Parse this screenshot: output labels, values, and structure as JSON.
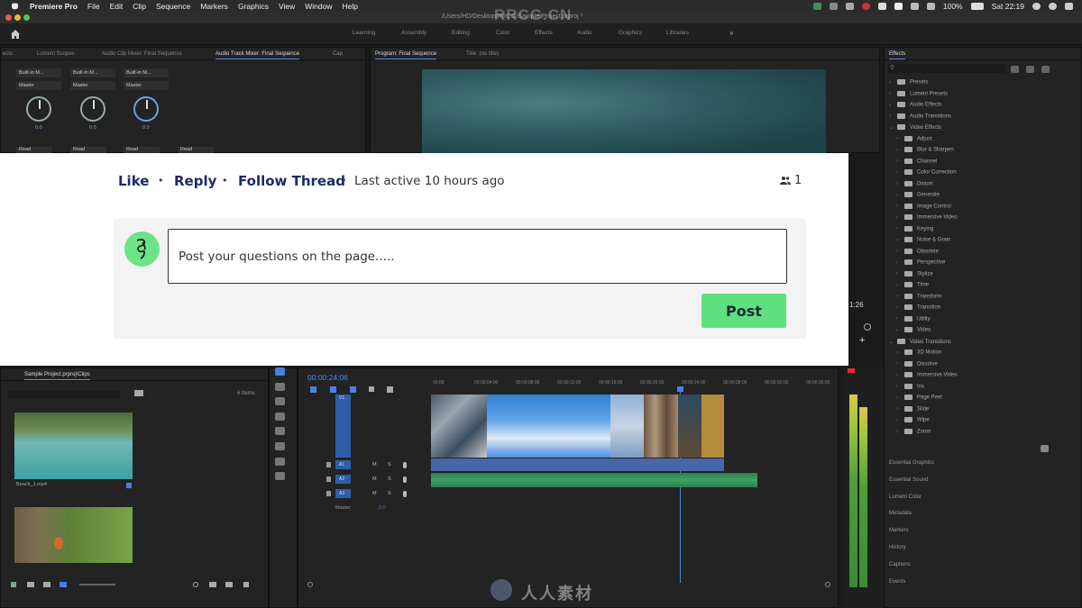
{
  "menubar": {
    "app_name": "Premiere Pro",
    "items": [
      "File",
      "Edit",
      "Clip",
      "Sequence",
      "Markers",
      "Graphics",
      "View",
      "Window",
      "Help"
    ],
    "battery": "100%",
    "clock": "Sat 22:19"
  },
  "titlebar": {
    "path": "/Users/HD/Desktop/RRCG/Sample Project.prproj *",
    "watermark": "RRCG.CN"
  },
  "workspaces": [
    "Learning",
    "Assembly",
    "Editing",
    "Color",
    "Effects",
    "Audio",
    "Graphics",
    "Libraries"
  ],
  "left_panel": {
    "tabs": [
      "ects",
      "Lumetri Scopes",
      "Audio Clip Mixer: Final Sequence",
      "Audio Track Mixer: Final Sequence",
      "Cap"
    ],
    "active_tab": "Audio Track Mixer: Final Sequence",
    "channels": [
      {
        "input": "Built-in M...",
        "output": "Master",
        "value": "0.0",
        "mode": "Read"
      },
      {
        "input": "Built-in M...",
        "output": "Master",
        "value": "0.0",
        "mode": "Read"
      },
      {
        "input": "Built-in M...",
        "output": "Master",
        "value": "0.0",
        "mode": "Read"
      }
    ],
    "fourth_mode": "Read"
  },
  "program_monitor": {
    "tabs": [
      "Program: Final Sequence",
      "Title: (no title)"
    ],
    "time_fragment": "1:26"
  },
  "effects_panel": {
    "title": "Effects",
    "tree": [
      {
        "label": "Presets",
        "level": 0
      },
      {
        "label": "Lumetri Presets",
        "level": 0
      },
      {
        "label": "Audio Effects",
        "level": 0
      },
      {
        "label": "Audio Transitions",
        "level": 0
      },
      {
        "label": "Video Effects",
        "level": 0,
        "expanded": true
      },
      {
        "label": "Adjust",
        "level": 1
      },
      {
        "label": "Blur & Sharpen",
        "level": 1
      },
      {
        "label": "Channel",
        "level": 1
      },
      {
        "label": "Color Correction",
        "level": 1
      },
      {
        "label": "Distort",
        "level": 1
      },
      {
        "label": "Generate",
        "level": 1
      },
      {
        "label": "Image Control",
        "level": 1
      },
      {
        "label": "Immersive Video",
        "level": 1
      },
      {
        "label": "Keying",
        "level": 1
      },
      {
        "label": "Noise & Grain",
        "level": 1
      },
      {
        "label": "Obsolete",
        "level": 1
      },
      {
        "label": "Perspective",
        "level": 1
      },
      {
        "label": "Stylize",
        "level": 1
      },
      {
        "label": "Time",
        "level": 1
      },
      {
        "label": "Transform",
        "level": 1
      },
      {
        "label": "Transition",
        "level": 1
      },
      {
        "label": "Utility",
        "level": 1
      },
      {
        "label": "Video",
        "level": 1
      },
      {
        "label": "Video Transitions",
        "level": 0,
        "expanded": true
      },
      {
        "label": "3D Motion",
        "level": 1
      },
      {
        "label": "Dissolve",
        "level": 1
      },
      {
        "label": "Immersive Video",
        "level": 1
      },
      {
        "label": "Iris",
        "level": 1
      },
      {
        "label": "Page Peel",
        "level": 1
      },
      {
        "label": "Slide",
        "level": 1
      },
      {
        "label": "Wipe",
        "level": 1
      },
      {
        "label": "Zoom",
        "level": 1
      }
    ],
    "bottom_panels": [
      "Essential Graphics",
      "Essential Sound",
      "Lumetri Color",
      "Metadata",
      "Markers",
      "History",
      "Captions",
      "Events"
    ]
  },
  "project_panel": {
    "title": "Sample Project.prproj\\Clips",
    "item_count": "6 Items",
    "clips": [
      {
        "name": "Beach_1.mp4"
      },
      {
        "name": ""
      }
    ]
  },
  "timeline": {
    "timecode": "00:00:24:06",
    "ruler": [
      "00:00",
      "00:00:04:00",
      "00:00:08:00",
      "00:00:12:00",
      "00:00:16:00",
      "00:00:20:00",
      "00:00:24:00",
      "00:00:28:00",
      "00:00:32:00",
      "00:00:36:00"
    ],
    "video_track": "V1",
    "audio_tracks": [
      "A1",
      "A2",
      "A3"
    ],
    "master_label": "Master",
    "master_value": "0.0"
  },
  "comment_card": {
    "actions": [
      "Like",
      "Reply",
      "Follow Thread"
    ],
    "last_active": "Last active 10 hours ago",
    "participants": "1",
    "input_placeholder": "Post your questions on the page.....",
    "post_label": "Post"
  },
  "bottom_watermark": "人人素材",
  "colors": {
    "accent_blue": "#4a8cf0",
    "post_green": "#5fe07f",
    "action_navy": "#1b2a6b"
  }
}
